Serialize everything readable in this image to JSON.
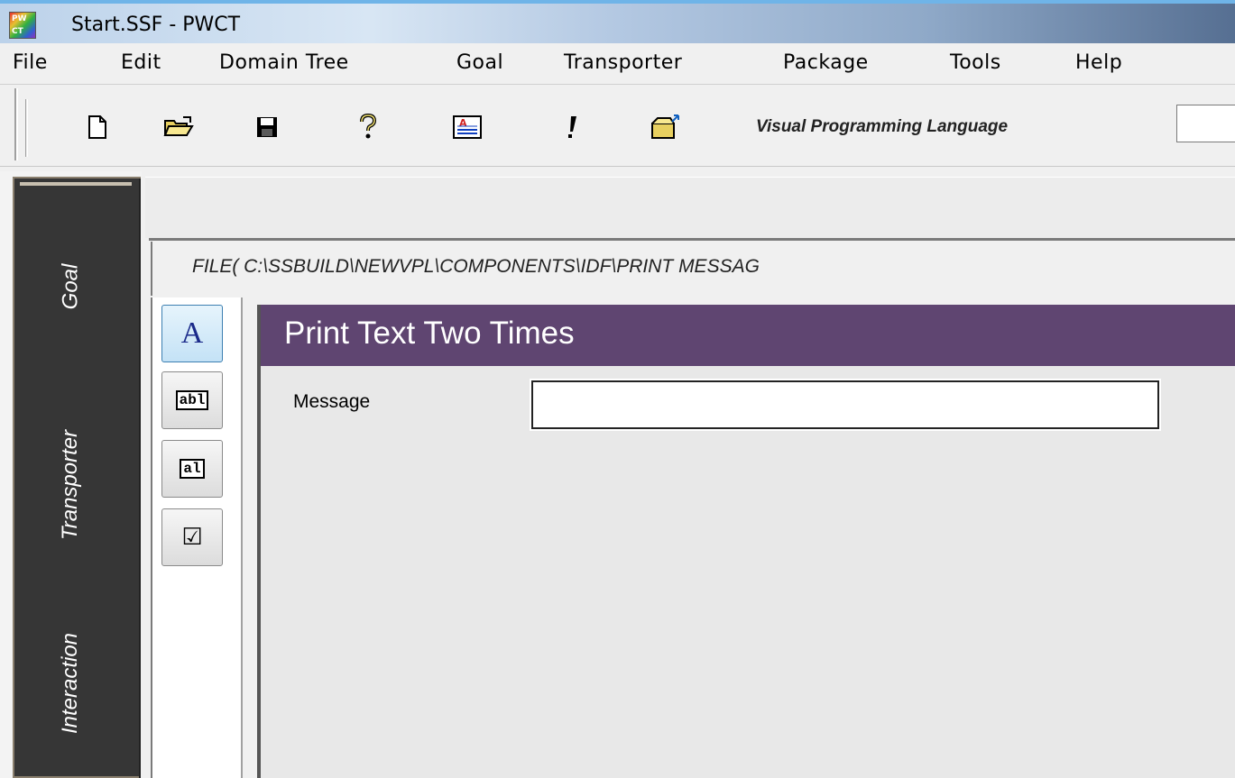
{
  "window": {
    "title": "Start.SSF  - PWCT",
    "logo_text": "PW CT"
  },
  "menu": {
    "items": [
      "File",
      "Edit",
      "Domain Tree",
      "Goal",
      "Transporter",
      "Package",
      "Tools",
      "Help"
    ]
  },
  "toolbar": {
    "buttons": [
      "new-file-icon",
      "open-folder-icon",
      "save-disk-icon",
      "help-icon",
      "text-document-icon",
      "run-exclamation-icon",
      "open-package-icon"
    ],
    "label": "Visual Programming Language",
    "input_value": ""
  },
  "sidebar": {
    "tabs": [
      "Goal",
      "Transporter",
      "Interaction"
    ]
  },
  "content": {
    "path": "FILE( C:\\SSBUILD\\NEWVPL\\COMPONENTS\\IDF\\PRINT MESSAG"
  },
  "tools": [
    {
      "name": "label-tool",
      "glyph": "A"
    },
    {
      "name": "textbox-tool",
      "glyph": "abl"
    },
    {
      "name": "listbox-tool",
      "glyph": "al"
    },
    {
      "name": "checkbox-tool",
      "glyph": "☑"
    }
  ],
  "form": {
    "title": "Print Text Two Times",
    "message_label": "Message",
    "message_value": ""
  },
  "colors": {
    "form_title_bg": "#5f4571",
    "sidebar_bg": "#363636",
    "selected_tool": "#c4e2f6"
  }
}
